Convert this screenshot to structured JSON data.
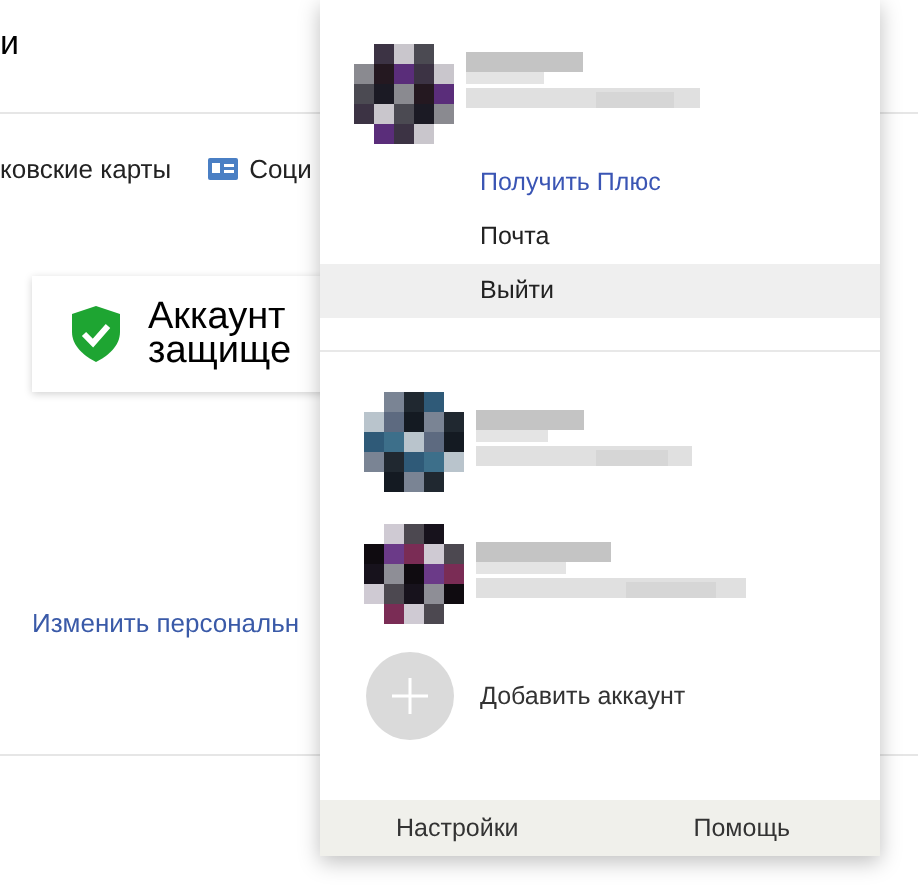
{
  "header": {
    "title_fragment": "и"
  },
  "nav": [
    {
      "label": "ковские карты",
      "icon": false
    },
    {
      "label": "Соци",
      "icon": true
    }
  ],
  "security_card": {
    "lines": [
      "Аккаунт",
      "защище"
    ],
    "protected": true
  },
  "personal_link": "Изменить персональн",
  "account_menu": {
    "current_account": {
      "avatar": {
        "kind": "picture"
      },
      "actions": [
        {
          "label": "Получить Плюс",
          "kind": "promo",
          "hovered": false
        },
        {
          "label": "Почта",
          "kind": "plain",
          "hovered": false
        },
        {
          "label": "Выйти",
          "kind": "plain",
          "hovered": true
        }
      ]
    },
    "other_accounts": [
      {
        "kind": "picture"
      },
      {
        "kind": "picture"
      }
    ],
    "add_account": "Добавить аккаунт",
    "footer": [
      "Настройки",
      "Помощь"
    ]
  }
}
